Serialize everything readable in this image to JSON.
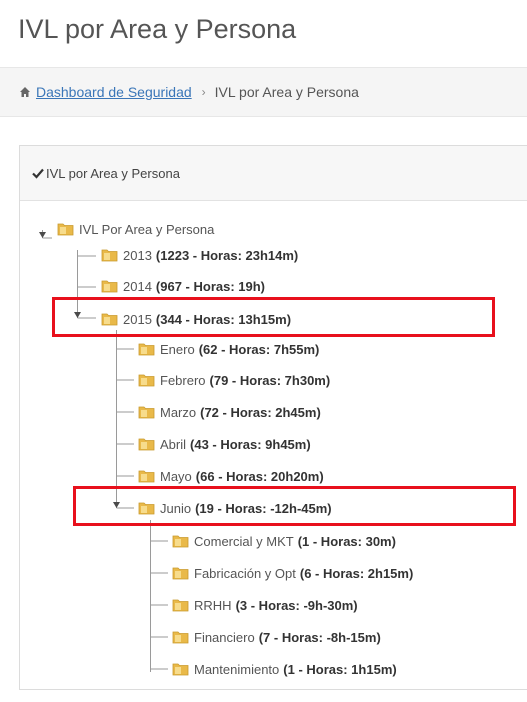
{
  "page": {
    "title": "IVL por Area y Persona"
  },
  "breadcrumb": {
    "home_icon": "home-icon",
    "link": "Dashboard de Seguridad",
    "separator": "›",
    "current": "IVL por Area y Persona"
  },
  "panel": {
    "header_icon": "check-icon",
    "title": "IVL por Area y Persona"
  },
  "tree": {
    "root": {
      "label": "IVL Por Area y Persona"
    },
    "years": [
      {
        "label": "2013",
        "count": "(1223 - Horas: 23h14m)"
      },
      {
        "label": "2014",
        "count": "(967 - Horas: 19h)"
      },
      {
        "label": "2015",
        "count": "(344 - Horas: 13h15m)"
      }
    ],
    "months": [
      {
        "label": "Enero",
        "count": "(62 - Horas: 7h55m)"
      },
      {
        "label": "Febrero",
        "count": "(79 - Horas: 7h30m)"
      },
      {
        "label": "Marzo",
        "count": "(72 - Horas: 2h45m)"
      },
      {
        "label": "Abril",
        "count": "(43 - Horas: 9h45m)"
      },
      {
        "label": "Mayo",
        "count": "(66 - Horas: 20h20m)"
      },
      {
        "label": "Junio",
        "count": "(19 - Horas: -12h-45m)"
      }
    ],
    "areas": [
      {
        "label": "Comercial y MKT",
        "count": "(1 - Horas: 30m)"
      },
      {
        "label": "Fabricación y Opt",
        "count": "(6 - Horas: 2h15m)"
      },
      {
        "label": "RRHH",
        "count": "(3 - Horas: -9h-30m)"
      },
      {
        "label": "Financiero",
        "count": "(7 - Horas: -8h-15m)"
      },
      {
        "label": "Mantenimiento",
        "count": "(1 - Horas: 1h15m)"
      }
    ]
  },
  "colors": {
    "highlight": "#e8101c",
    "link": "#3a76b8",
    "folder": "#e9b949"
  }
}
